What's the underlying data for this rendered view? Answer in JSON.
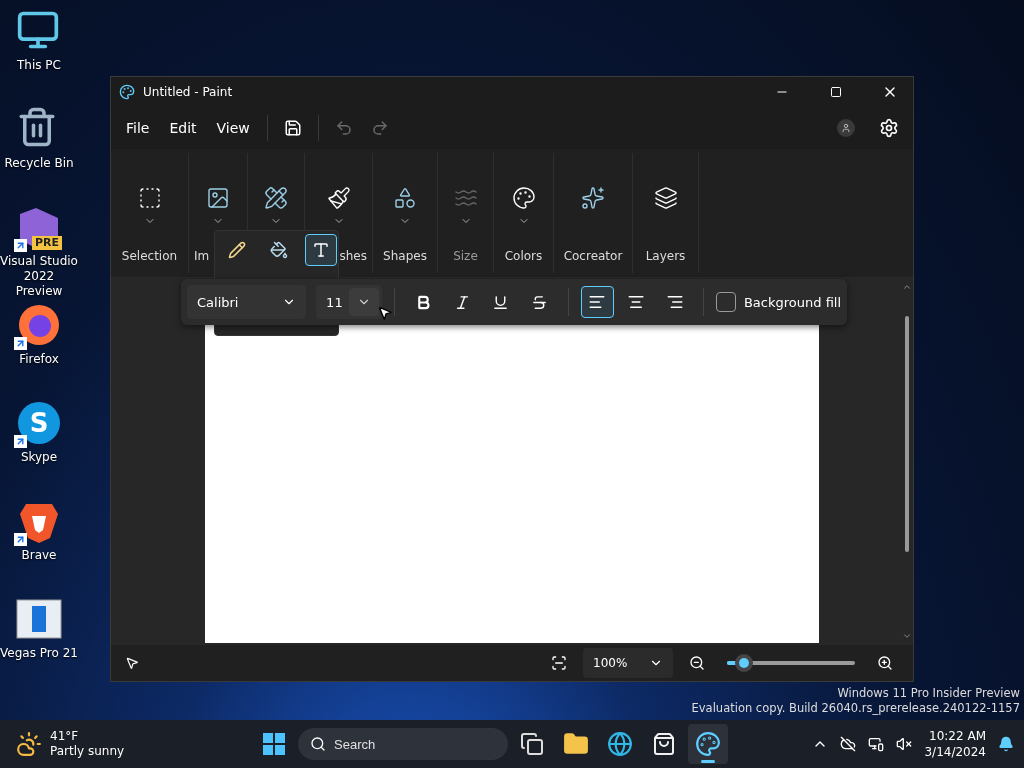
{
  "desktop_icons": [
    {
      "label": "This PC",
      "kind": "pc",
      "shortcut": false
    },
    {
      "label": "Recycle Bin",
      "kind": "bin",
      "shortcut": false
    },
    {
      "label": "Visual Studio 2022 Preview",
      "kind": "vs",
      "badge": "PRE",
      "shortcut": true
    },
    {
      "label": "Firefox",
      "kind": "firefox",
      "shortcut": true
    },
    {
      "label": "Skype",
      "kind": "skype",
      "badge": "S",
      "shortcut": true
    },
    {
      "label": "Brave",
      "kind": "brave",
      "shortcut": true
    },
    {
      "label": "Vegas Pro 21",
      "kind": "vegas",
      "shortcut": false
    }
  ],
  "window": {
    "title": "Untitled - Paint",
    "menu": [
      "File",
      "Edit",
      "View"
    ],
    "quick_actions": [
      {
        "kind": "save",
        "disabled": false
      },
      {
        "kind": "undo",
        "disabled": true
      },
      {
        "kind": "redo",
        "disabled": true
      }
    ],
    "ribbon": [
      {
        "label": "Selection",
        "kind": "selection",
        "disabled": false,
        "dropdown": true
      },
      {
        "label": "Im",
        "kind": "image",
        "disabled": false,
        "dropdown": true
      },
      {
        "kind": "tools",
        "disabled": false,
        "dropdown": true
      },
      {
        "label": "shes",
        "kind": "brushes",
        "disabled": false,
        "dropdown": true
      },
      {
        "label": "Shapes",
        "kind": "shapes",
        "disabled": false,
        "dropdown": true
      },
      {
        "label": "Size",
        "kind": "size",
        "disabled": true,
        "dropdown": true
      },
      {
        "label": "Colors",
        "kind": "colors",
        "disabled": false,
        "dropdown": true
      },
      {
        "label": "Cocreator",
        "kind": "cocreator",
        "disabled": false,
        "dropdown": false
      },
      {
        "label": "Layers",
        "kind": "layers",
        "disabled": false,
        "dropdown": false
      }
    ],
    "tool_popup": [
      {
        "kind": "pencil",
        "selected": false
      },
      {
        "kind": "fill",
        "selected": false
      },
      {
        "kind": "text",
        "selected": true
      }
    ],
    "text_toolbar": {
      "font": "Calibri",
      "size": "11",
      "styles": [
        {
          "kind": "bold",
          "selected": false
        },
        {
          "kind": "italic",
          "selected": false
        },
        {
          "kind": "underline",
          "selected": false
        },
        {
          "kind": "strikethrough",
          "selected": false
        }
      ],
      "alignments": [
        {
          "kind": "left",
          "selected": true
        },
        {
          "kind": "center",
          "selected": false
        },
        {
          "kind": "right",
          "selected": false
        }
      ],
      "background_fill": {
        "label": "Background fill",
        "checked": false
      }
    },
    "status_bar": {
      "zoom": "100%",
      "level": 0.13
    }
  },
  "os_notice": [
    "Windows 11 Pro Insider Preview",
    "Evaluation copy. Build 26040.rs_prerelease.240122-1157"
  ],
  "taskbar": {
    "weather": {
      "temperature": "41°F",
      "condition": "Partly sunny"
    },
    "search": {
      "placeholder": "Search"
    },
    "apps": [
      {
        "kind": "taskview",
        "selected": false
      },
      {
        "kind": "explorer",
        "selected": false
      },
      {
        "kind": "edge",
        "selected": false
      },
      {
        "kind": "store",
        "selected": false
      },
      {
        "kind": "paint",
        "selected": true
      }
    ],
    "time": "10:22 AM",
    "date": "3/14/2024"
  }
}
